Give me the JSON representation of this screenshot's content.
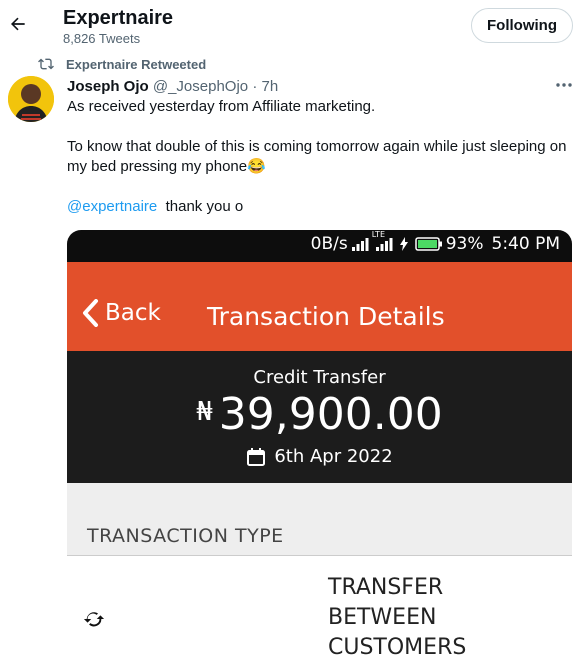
{
  "profile": {
    "name": "Expertnaire",
    "tweet_count": "8,826 Tweets",
    "follow_label": "Following"
  },
  "tweet": {
    "retweet_label": "Expertnaire Retweeted",
    "author_name": "Joseph Ojo",
    "author_handle": "@_JosephOjo",
    "time": "· 7h",
    "line1": "As received yesterday from Affiliate marketing.",
    "line2": "To know that double of this is coming tomorrow again while just sleeping on my bed pressing my phone😂",
    "mention": "@expertnaire",
    "line3_rest": "  thank you o"
  },
  "screenshot": {
    "status_text": "0B/s",
    "network_label": "LTE",
    "battery": "93%",
    "time": "5:40 PM",
    "back_label": "Back",
    "title": "Transaction Details",
    "kind": "Credit Transfer",
    "currency_symbol": "₦",
    "amount": "39,900.00",
    "date": "6th Apr 2022",
    "type_header": "TRANSACTION TYPE",
    "type_value": [
      "TRANSFER",
      "BETWEEN",
      "CUSTOMERS"
    ]
  },
  "colors": {
    "app_orange": "#e2502b",
    "mention_blue": "#1d9bf0",
    "battery_green": "#4cd964"
  }
}
